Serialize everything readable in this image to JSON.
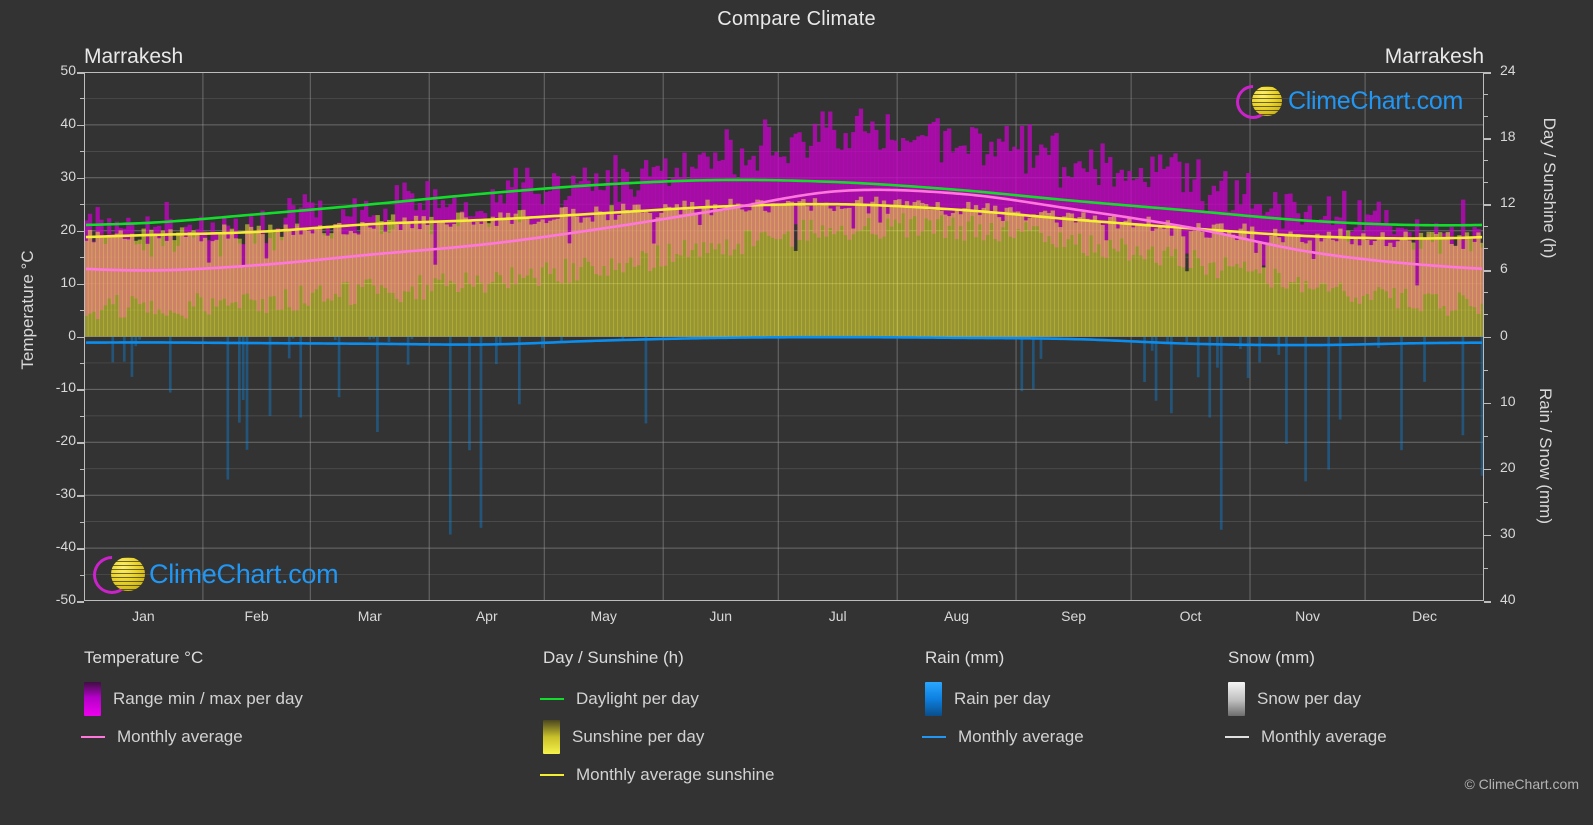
{
  "header": {
    "title": "Compare Climate",
    "city_left": "Marrakesh",
    "city_right": "Marrakesh"
  },
  "watermark": {
    "text": "ClimeChart.com"
  },
  "footer": {
    "copyright": "© ClimeChart.com"
  },
  "axes": {
    "left_title": "Temperature °C",
    "right_title_top": "Day / Sunshine (h)",
    "right_title_bottom": "Rain / Snow (mm)",
    "left_ticks": [
      "50",
      "40",
      "30",
      "20",
      "10",
      "0",
      "-10",
      "-20",
      "-30",
      "-40",
      "-50"
    ],
    "right_ticks_top": [
      "24",
      "18",
      "12",
      "6",
      "0"
    ],
    "right_ticks_bottom": [
      "10",
      "20",
      "30",
      "40"
    ],
    "x_ticks": [
      "Jan",
      "Feb",
      "Mar",
      "Apr",
      "May",
      "Jun",
      "Jul",
      "Aug",
      "Sep",
      "Oct",
      "Nov",
      "Dec"
    ]
  },
  "legend": {
    "columns": [
      {
        "heading": "Temperature °C",
        "items": [
          {
            "label": "Range min / max per day",
            "swatch": "gradient",
            "color": "#cc00cc"
          },
          {
            "label": "Monthly average",
            "swatch": "line",
            "color": "#ff77dd"
          }
        ]
      },
      {
        "heading": "Day / Sunshine (h)",
        "items": [
          {
            "label": "Daylight per day",
            "swatch": "line",
            "color": "#12dd2a"
          },
          {
            "label": "Sunshine per day",
            "swatch": "gradient",
            "color": "#f2ee33"
          },
          {
            "label": "Monthly average sunshine",
            "swatch": "line",
            "color": "#f2ee33"
          }
        ]
      },
      {
        "heading": "Rain (mm)",
        "items": [
          {
            "label": "Rain per day",
            "swatch": "gradient",
            "color": "#0a8ef0"
          },
          {
            "label": "Monthly average",
            "swatch": "line",
            "color": "#2196f3"
          }
        ]
      },
      {
        "heading": "Snow (mm)",
        "items": [
          {
            "label": "Snow per day",
            "swatch": "gradient",
            "color": "#e8e8e8"
          },
          {
            "label": "Monthly average",
            "swatch": "line",
            "color": "#e0e0e0"
          }
        ]
      }
    ]
  },
  "colors": {
    "background": "#333333",
    "grid": "#9a9a9a",
    "axis": "#bdbdbd",
    "text": "#d9d9d9",
    "temp_range": "#cc00cc",
    "temp_avg": "#ff77dd",
    "daylight": "#12dd2a",
    "sunshine": "#f2ee33",
    "sunshine_area": "#a5a024",
    "rain": "#0a8ef0",
    "logo_word": "#2196f3",
    "logo_ring": "#cc22cc",
    "logo_ball": "#e8d22a"
  },
  "chart_data": {
    "type": "area",
    "title": "Compare Climate",
    "subtitle": "Marrakesh",
    "xlabel": "",
    "ylabel": "Temperature °C",
    "ylabel_right_top": "Day / Sunshine (h)",
    "ylabel_right_bottom": "Rain / Snow (mm)",
    "ylim": [
      -50,
      50
    ],
    "ylim_right_top": [
      0,
      24
    ],
    "ylim_right_bottom": [
      0,
      40
    ],
    "grid": true,
    "legend_position": "below",
    "categories": [
      "Jan",
      "Feb",
      "Mar",
      "Apr",
      "May",
      "Jun",
      "Jul",
      "Aug",
      "Sep",
      "Oct",
      "Nov",
      "Dec"
    ],
    "series": [
      {
        "name": "Monthly average temperature",
        "unit": "°C",
        "color": "#ff77dd",
        "values": [
          12.5,
          13.5,
          15.5,
          17.5,
          20.5,
          24.0,
          27.5,
          27.0,
          24.0,
          20.5,
          16.0,
          13.5
        ]
      },
      {
        "name": "Daily max temperature (range top)",
        "unit": "°C",
        "color": "#cc00cc",
        "values": [
          19.5,
          20.5,
          23.5,
          25.5,
          29.0,
          33.5,
          38.0,
          37.5,
          32.5,
          28.0,
          23.0,
          20.0
        ]
      },
      {
        "name": "Daily min temperature (range bottom)",
        "unit": "°C",
        "color": "#cc00cc",
        "values": [
          5.5,
          6.5,
          8.5,
          10.5,
          13.5,
          17.0,
          20.5,
          20.5,
          18.0,
          14.5,
          9.5,
          6.5
        ]
      },
      {
        "name": "Daylight per day",
        "unit": "h",
        "color": "#12dd2a",
        "values": [
          10.3,
          11.1,
          12.0,
          13.0,
          13.8,
          14.2,
          14.0,
          13.3,
          12.3,
          11.4,
          10.5,
          10.1
        ]
      },
      {
        "name": "Monthly average sunshine",
        "unit": "h",
        "color": "#f2ee33",
        "values": [
          9.2,
          9.5,
          10.2,
          10.6,
          11.2,
          11.8,
          12.0,
          11.5,
          10.6,
          9.8,
          9.1,
          8.9
        ]
      },
      {
        "name": "Monthly average rain",
        "unit": "mm",
        "color": "#2196f3",
        "values": [
          0.9,
          1.0,
          1.1,
          1.2,
          0.6,
          0.2,
          0.1,
          0.2,
          0.4,
          1.1,
          1.3,
          1.0
        ]
      },
      {
        "name": "Monthly average snow",
        "unit": "mm",
        "color": "#e0e0e0",
        "values": [
          0,
          0,
          0,
          0,
          0,
          0,
          0,
          0,
          0,
          0,
          0,
          0
        ]
      }
    ]
  }
}
